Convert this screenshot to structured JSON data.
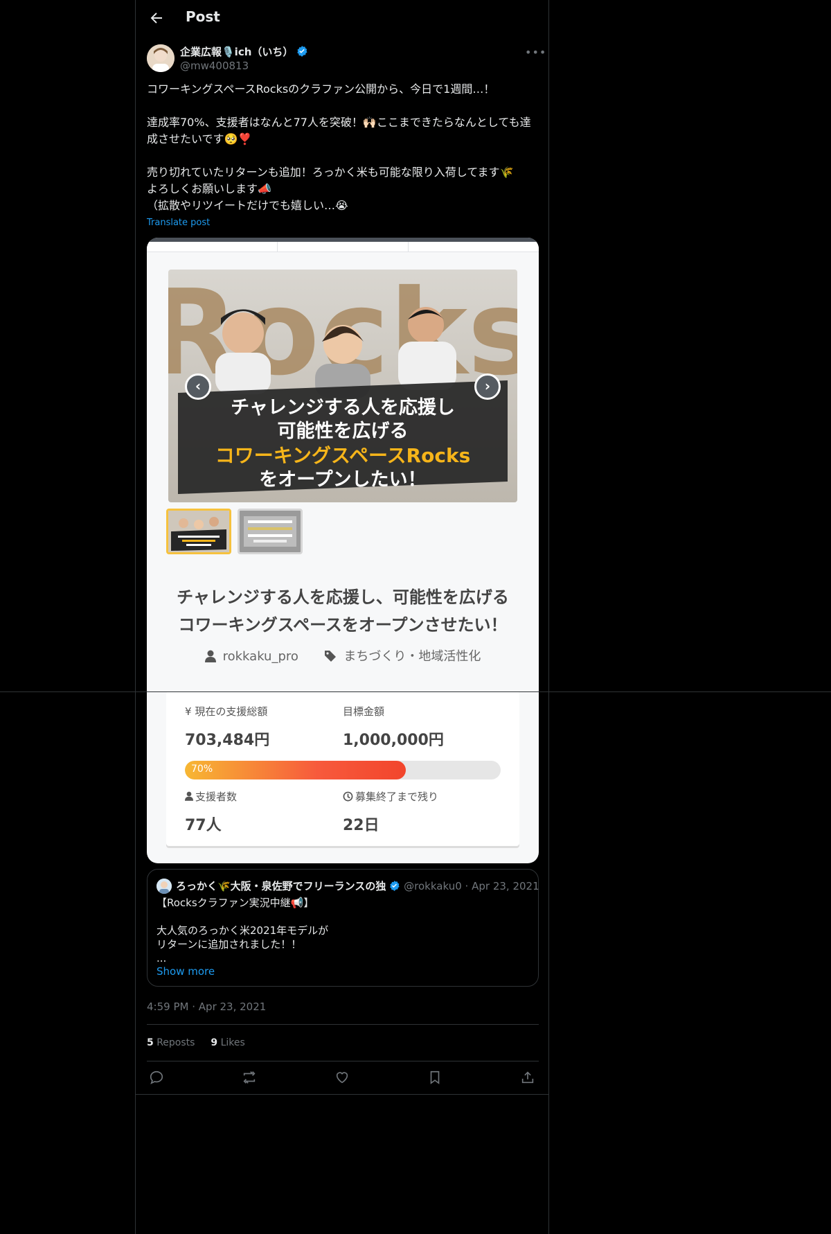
{
  "header": {
    "title": "Post"
  },
  "author": {
    "name": "企業広報🎙️ich（いち）",
    "handle": "@mw400813"
  },
  "tweet": {
    "lines": [
      "コワーキングスペースRocksのクラファン公開から、今日で1週間…！",
      "達成率70%、支援者はなんと77人を突破！🙌🏻ここまできたらなんとしても達成させたいです🥺❣️",
      "売り切れていたリターンも追加！ろっかく米も可能な限り入荷してます🌾",
      "よろしくお願いします📣",
      "（拡散やリツイートだけでも嬉しい…😭"
    ],
    "translate_label": "Translate post"
  },
  "card": {
    "hero_caption_lines": [
      "チャレンジする人を応援し",
      "可能性を広げる",
      "コワーキングスペースRocks",
      "をオープンしたい！"
    ],
    "hero_logo": "Rocks",
    "title_lines": [
      "チャレンジする人を応援し、可能性を広げる",
      "コワーキングスペースをオープンさせたい！"
    ],
    "owner": "rokkaku_pro",
    "category": "まちづくり・地域活性化",
    "stats": {
      "current_label": "現在の支援総額",
      "current_value": "703,484円",
      "goal_label": "目標金額",
      "goal_value": "1,000,000円",
      "progress_text": "70%",
      "progress_fraction": 0.7,
      "backers_label": "支援者数",
      "backers_value": "77人",
      "remaining_label": "募集終了まで残り",
      "remaining_value": "22日"
    }
  },
  "quote": {
    "name": "ろっかく🌾大阪・泉佐野でフリーランスの独",
    "handle": "@rokkaku0",
    "dot": "·",
    "date": "Apr 23, 2021",
    "lines": [
      "【Rocksクラファン実況中継📢】",
      "",
      "大人気のろっかく米2021年モデルが",
      "リターンに追加されました！！",
      "..."
    ],
    "show_more": "Show more"
  },
  "meta": {
    "time": "4:59 PM",
    "dot": "·",
    "date": "Apr 23, 2021"
  },
  "counts": {
    "reposts_num": "5",
    "reposts_label": "Reposts",
    "likes_num": "9",
    "likes_label": "Likes"
  },
  "colors": {
    "accent": "#1d9bf0",
    "progress_start": "#f7b733",
    "progress_end": "#f2452c"
  }
}
